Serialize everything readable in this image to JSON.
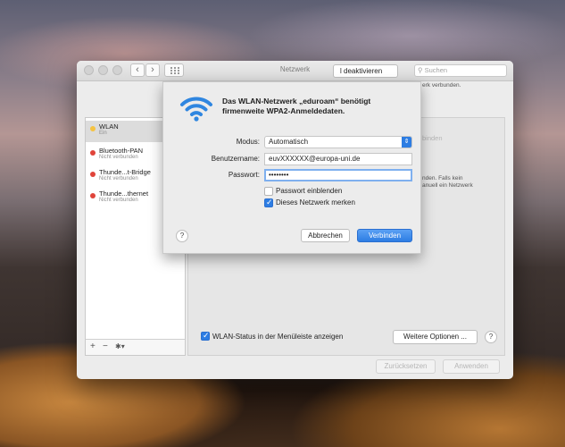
{
  "window": {
    "title": "Netzwerk",
    "search_placeholder": "Suchen",
    "nav_back": "‹",
    "nav_forward": "›"
  },
  "sidebar": {
    "items": [
      {
        "name": "WLAN",
        "status": "Ein",
        "dot_color": "#f5c342",
        "selected": true
      },
      {
        "name": "Bluetooth-PAN",
        "status": "Nicht verbunden",
        "dot_color": "#e0443a",
        "selected": false
      },
      {
        "name": "Thunde...t-Bridge",
        "status": "Nicht verbunden",
        "dot_color": "#e0443a",
        "selected": false
      },
      {
        "name": "Thunde...thernet",
        "status": "Nicht verbunden",
        "dot_color": "#e0443a",
        "selected": false
      }
    ],
    "add_label": "+",
    "remove_label": "−",
    "action_label": "✱▾"
  },
  "panel": {
    "deactivate_label": "l deaktivieren",
    "connected_text": "erk verbunden.",
    "join_text": "binden",
    "info_text_1": "nden. Falls kein",
    "info_text_2": "anuell ein Netzwerk",
    "show_status_label": "WLAN-Status in der Menüleiste anzeigen",
    "show_status_checked": true,
    "more_options_label": "Weitere Optionen ...",
    "help_label": "?",
    "revert_label": "Zurücksetzen",
    "apply_label": "Anwenden"
  },
  "sheet": {
    "message": "Das WLAN-Netzwerk „eduroam“ benötigt firmenweite WPA2-Anmeldedaten.",
    "mode_label": "Modus:",
    "mode_value": "Automatisch",
    "username_label": "Benutzername:",
    "username_value": "euvXXXXXX@europa-uni.de",
    "password_label": "Passwort:",
    "password_value": "••••••••",
    "show_password_label": "Passwort einblenden",
    "show_password_checked": false,
    "remember_label": "Dieses Netzwerk merken",
    "remember_checked": true,
    "help_label": "?",
    "cancel_label": "Abbrechen",
    "connect_label": "Verbinden",
    "accent_color": "#2d7de3",
    "wifi_icon_color": "#2f86e0"
  }
}
